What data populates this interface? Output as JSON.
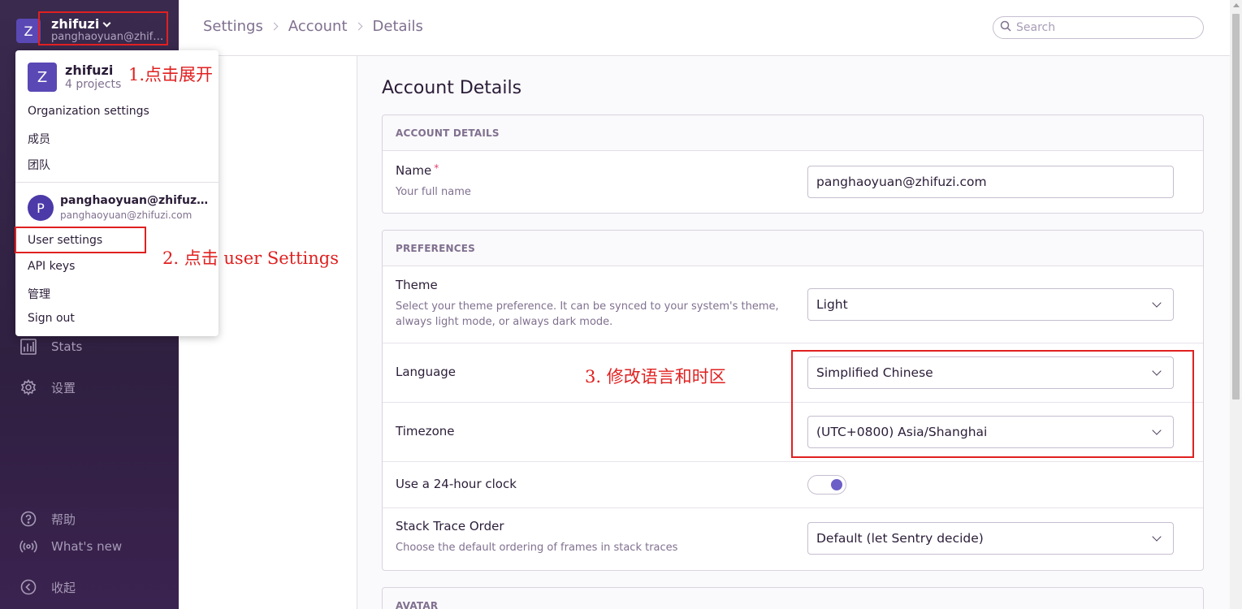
{
  "sidebar": {
    "org_initial": "Z",
    "org_name": "zhifuzi",
    "org_email": "panghaoyuan@zhifuzi.com",
    "items": [
      {
        "label": "Stats",
        "icon": "stats-icon"
      },
      {
        "label": "设置",
        "icon": "gear-icon"
      },
      {
        "label": "帮助",
        "icon": "help-icon"
      },
      {
        "label": "What's new",
        "icon": "broadcast-icon"
      },
      {
        "label": "收起",
        "icon": "collapse-icon"
      }
    ]
  },
  "header": {
    "breadcrumb": [
      "Settings",
      "Account",
      "Details"
    ],
    "search_placeholder": "Search"
  },
  "page": {
    "title": "Account Details",
    "account_panel": {
      "heading": "ACCOUNT DETAILS",
      "name_label": "Name",
      "name_required": "*",
      "name_help": "Your full name",
      "name_value": "panghaoyuan@zhifuzi.com"
    },
    "preferences_panel": {
      "heading": "PREFERENCES",
      "theme_label": "Theme",
      "theme_help": "Select your theme preference. It can be synced to your system's theme, always light mode, or always dark mode.",
      "theme_value": "Light",
      "language_label": "Language",
      "language_value": "Simplified Chinese",
      "timezone_label": "Timezone",
      "timezone_value": "(UTC+0800) Asia/Shanghai",
      "clock_label": "Use a 24-hour clock",
      "clock_on": true,
      "stack_label": "Stack Trace Order",
      "stack_help": "Choose the default ordering of frames in stack traces",
      "stack_value": "Default (let Sentry decide)"
    },
    "avatar_panel": {
      "heading": "AVATAR"
    }
  },
  "menu": {
    "org_initial": "Z",
    "org_name": "zhifuzi",
    "org_projects": "4 projects",
    "org_items": [
      "Organization settings",
      "成员",
      "团队"
    ],
    "user_initial": "P",
    "user_name": "panghaoyuan@zhifuzi.com",
    "user_email": "panghaoyuan@zhifuzi.com",
    "user_items": [
      "User settings",
      "API keys",
      "管理",
      "Sign out"
    ]
  },
  "annotations": {
    "step1": "1.点击展开",
    "step2": "2. 点击 user Settings",
    "step3": "3. 修改语言和时区",
    "color": "#e02020"
  },
  "colors": {
    "accent": "#6c5fc7",
    "sidebar_bg": "#2f1f40"
  }
}
